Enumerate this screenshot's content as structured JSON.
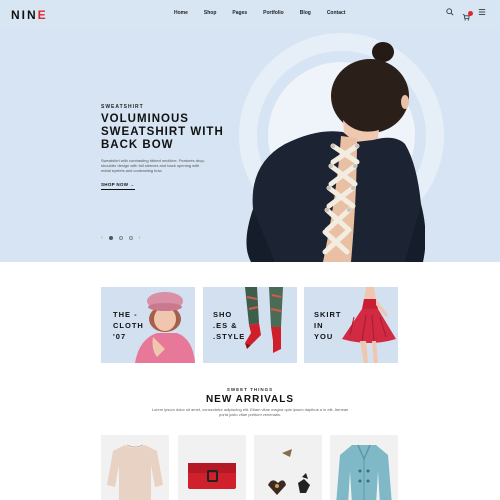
{
  "header": {
    "logo_main": "NIN",
    "logo_accent": "E",
    "nav": [
      {
        "label": "Home"
      },
      {
        "label": "Shop"
      },
      {
        "label": "Pages"
      },
      {
        "label": "Portfolio"
      },
      {
        "label": "Blog"
      },
      {
        "label": "Contact"
      }
    ],
    "icons": [
      "search-icon",
      "cart-icon",
      "menu-icon"
    ]
  },
  "hero": {
    "eyebrow": "SWEATSHIRT",
    "title_line1": "VOLUMINOUS",
    "title_line2": "SWEATSHIRT WITH",
    "title_line3": "BACK BOW",
    "description": "Sweatshirt with contrasting ribbed neckline. Features drop-shoulder design with full sleeves and back opening with metal eyelets and contrasting bow.",
    "cta": "SHOP NOW",
    "cta_arrow": "→",
    "prev_arrow": "‹",
    "next_arrow": "›",
    "slide_count": 3,
    "active_slide": 1
  },
  "categories": [
    {
      "line1": "THE -",
      "line2": "CLOTH",
      "line3": "'07"
    },
    {
      "line1": "SHO",
      "line2": ".ES  &",
      "line3": ".STYLE"
    },
    {
      "line1": "SKIRT",
      "line2": "IN",
      "line3": "YOU"
    }
  ],
  "arrivals": {
    "subtitle": "SWEET THINGS",
    "title": "NEW ARRIVALS",
    "description": "Lorem ipsum dolor sit amet, consectetur adipiscing elit. Etiam vitae magna quis ipsum dapibus a in elit. Aenean porta justo vitae pretium venenatis."
  },
  "products": [
    {
      "name": "beige-knit-sweater"
    },
    {
      "name": "red-clutch-bag"
    },
    {
      "name": "brooch-pins"
    },
    {
      "name": "teal-coat"
    }
  ],
  "colors": {
    "hero_bg": "#d6e4f3",
    "accent": "#e3262d",
    "tile_bg": "#d2e0ef"
  }
}
